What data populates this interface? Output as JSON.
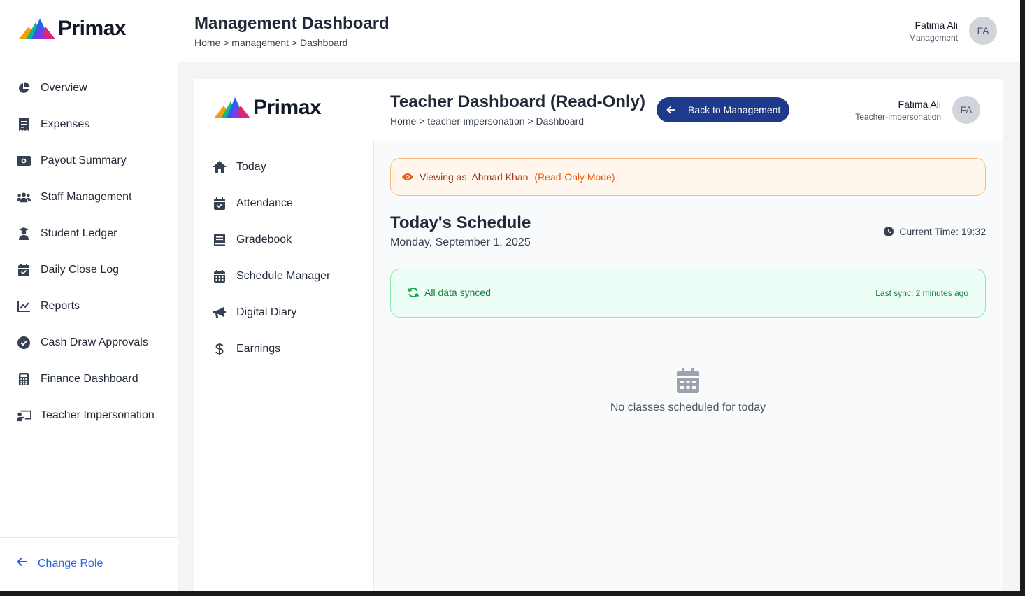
{
  "brand": {
    "name": "Primax"
  },
  "header": {
    "title": "Management Dashboard",
    "breadcrumb": "Home > management > Dashboard",
    "user": {
      "name": "Fatima Ali",
      "role": "Management",
      "initials": "FA"
    }
  },
  "sidebar": {
    "items": [
      {
        "label": "Overview",
        "icon": "chart-pie-icon"
      },
      {
        "label": "Expenses",
        "icon": "receipt-icon"
      },
      {
        "label": "Payout Summary",
        "icon": "money-bill-icon"
      },
      {
        "label": "Staff Management",
        "icon": "users-icon"
      },
      {
        "label": "Student Ledger",
        "icon": "student-icon"
      },
      {
        "label": "Daily Close Log",
        "icon": "calendar-check-icon"
      },
      {
        "label": "Reports",
        "icon": "line-chart-icon"
      },
      {
        "label": "Cash Draw Approvals",
        "icon": "check-circle-icon"
      },
      {
        "label": "Finance Dashboard",
        "icon": "calculator-icon"
      },
      {
        "label": "Teacher Impersonation",
        "icon": "chalkboard-teacher-icon"
      }
    ],
    "footer": {
      "label": "Change Role",
      "icon": "arrow-left-icon"
    }
  },
  "inner": {
    "title": "Teacher Dashboard (Read-Only)",
    "breadcrumb": "Home > teacher-impersonation > Dashboard",
    "back_button": "Back to Management",
    "user": {
      "name": "Fatima Ali",
      "role": "Teacher-Impersonation",
      "initials": "FA"
    },
    "sidebar": {
      "items": [
        {
          "label": "Today",
          "icon": "home-icon"
        },
        {
          "label": "Attendance",
          "icon": "calendar-check-icon"
        },
        {
          "label": "Gradebook",
          "icon": "book-icon"
        },
        {
          "label": "Schedule Manager",
          "icon": "calendar-icon"
        },
        {
          "label": "Digital Diary",
          "icon": "megaphone-icon"
        },
        {
          "label": "Earnings",
          "icon": "dollar-icon"
        }
      ]
    },
    "banner": {
      "viewing_as": "Viewing as: Ahmad Khan",
      "mode": "(Read-Only Mode)"
    },
    "schedule": {
      "title": "Today's Schedule",
      "date": "Monday, September 1, 2025",
      "current_time": "Current Time: 19:32"
    },
    "sync": {
      "status": "All data synced",
      "last_sync": "Last sync: 2 minutes ago"
    },
    "empty_state": {
      "message": "No classes scheduled for today"
    }
  },
  "colors": {
    "accent": "#1e3a8a",
    "link": "#2563eb",
    "warning_bg": "#fff7ed",
    "warning_border": "#fdba74",
    "warning_text": "#ea580c",
    "success_bg": "#ecfdf5",
    "success_border": "#86efac",
    "success_text": "#15803d"
  }
}
